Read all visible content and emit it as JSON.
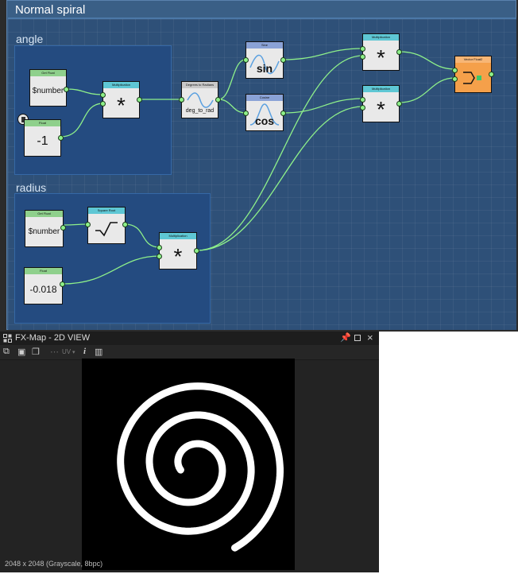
{
  "frame": {
    "title": "Normal spiral"
  },
  "groups": {
    "angle": "angle",
    "radius": "radius"
  },
  "nodes": {
    "get_float_1": {
      "header": "Get Float",
      "label": "$number"
    },
    "float_1": {
      "header": "Float",
      "label": "-1"
    },
    "mult_1": {
      "header": "Multiplication",
      "label": "*"
    },
    "deg_to_rad": {
      "header": "Degrees to Radians",
      "label": "deg_to_rad"
    },
    "sin": {
      "header": "Sine",
      "label": "sin"
    },
    "cos": {
      "header": "Cosine",
      "label": "cos"
    },
    "mult_top": {
      "header": "Multiplication",
      "label": "*"
    },
    "mult_bottom": {
      "header": "Multiplication",
      "label": "*"
    },
    "vector_float2": {
      "header": "Vector Float2"
    },
    "get_float_2": {
      "header": "Get Float",
      "label": "$number"
    },
    "square_root": {
      "header": "Square Root"
    },
    "float_2": {
      "header": "Float",
      "label": "-0.018"
    },
    "mult_radius": {
      "header": "Multiplication",
      "label": "*"
    }
  },
  "view": {
    "title": "FX-Map - 2D VIEW",
    "uv_label": "UV",
    "info_icon": "i",
    "status": "2048 x 2048 (Grayscale, 8bpc)"
  },
  "colors": {
    "wire": "#8ef08a",
    "frame": "#3a5f86",
    "group": "#244b80",
    "accent_orange": "#f5a04a"
  }
}
